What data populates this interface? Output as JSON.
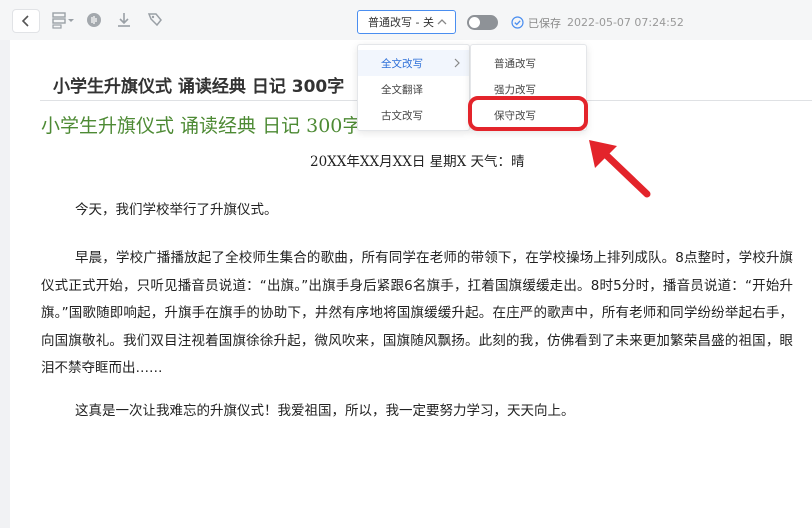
{
  "toolbar": {
    "mode_select_label": "普通改写 - 关",
    "save_status": "已保存",
    "save_timestamp": "2022-05-07 07:24:52",
    "toggle_on": false,
    "accent_color": "#4a8ef0"
  },
  "menu": {
    "left_items": [
      {
        "label": "全文改写",
        "active": true
      },
      {
        "label": "全文翻译",
        "active": false
      },
      {
        "label": "古文改写",
        "active": false
      }
    ],
    "right_items": [
      {
        "label": "普通改写"
      },
      {
        "label": "强力改写"
      },
      {
        "label": "保守改写"
      }
    ],
    "highlight_color": "#e3242b"
  },
  "document": {
    "title": "小学生升旗仪式 诵读经典 日记 300字",
    "heading": "小学生升旗仪式 诵读经典 日记 300字",
    "date_line": "20XX年XX月XX日 星期X 天气：晴",
    "paragraphs": [
      "今天，我们学校举行了升旗仪式。",
      "早晨，学校广播播放起了全校师生集合的歌曲，所有同学在老师的带领下，在学校操场上排列成队。8点整时，学校升旗仪式正式开始，只听见播音员说道：“出旗。”出旗手身后紧跟6名旗手，扛着国旗缓缓走出。8时5分时，播音员说道：“开始升旗。”国歌随即响起，升旗手在旗手的协助下，井然有序地将国旗缓缓升起。在庄严的歌声中，所有老师和同学纷纷举起右手，向国旗敬礼。我们双目注视着国旗徐徐升起，微风吹来，国旗随风飘扬。此刻的我，仿佛看到了未来更加繁荣昌盛的祖国，眼泪不禁夺眶而出……",
      "这真是一次让我难忘的升旗仪式！我爱祖国，所以，我一定要努力学习，天天向上。"
    ],
    "heading_color": "#4d8a34"
  }
}
